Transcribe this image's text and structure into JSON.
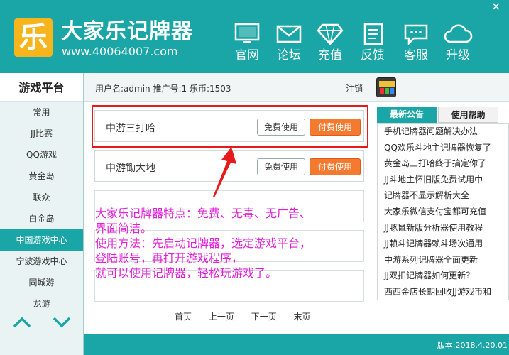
{
  "window": {
    "minimize_glyph": "—",
    "close_glyph": "×"
  },
  "header": {
    "logo_char": "乐",
    "brand_name": "大家乐记牌器",
    "brand_url": "www.40064007.com",
    "nav": [
      {
        "label": "官网",
        "icon": "monitor-icon"
      },
      {
        "label": "论坛",
        "icon": "envelope-icon"
      },
      {
        "label": "充值",
        "icon": "diamond-icon"
      },
      {
        "label": "反馈",
        "icon": "document-icon"
      },
      {
        "label": "客服",
        "icon": "chat-icon"
      },
      {
        "label": "升级",
        "icon": "cloud-icon"
      }
    ]
  },
  "sidebar": {
    "title": "游戏平台",
    "items": [
      {
        "label": "常用"
      },
      {
        "label": "JJ比赛"
      },
      {
        "label": "QQ游戏"
      },
      {
        "label": "黄金岛"
      },
      {
        "label": "联众"
      },
      {
        "label": "白金岛"
      },
      {
        "label": "中国游戏中心"
      },
      {
        "label": "宁波游戏中心"
      },
      {
        "label": "同城游"
      },
      {
        "label": "龙游"
      }
    ],
    "active_index": 6
  },
  "info_bar": {
    "user_text": "用户名:admin  推广号:1  乐币:1503",
    "logout": "注销"
  },
  "games": [
    {
      "name": "中游三打哈",
      "free_label": "免费使用",
      "paid_label": "付费使用"
    },
    {
      "name": "中游锄大地",
      "free_label": "免费使用",
      "paid_label": "付费使用"
    }
  ],
  "overlay_text": [
    "大家乐记牌器特点：免费、无毒、无广告、",
    "界面简洁。",
    "使用方法：先启动记牌器，选定游戏平台，",
    "登陆账号，再打开游戏程序，",
    "就可以使用记牌器，轻松玩游戏了。"
  ],
  "pager": {
    "first": "首页",
    "prev": "上一页",
    "next": "下一页",
    "last": "末页"
  },
  "right_panel": {
    "tabs": [
      "最新公告",
      "使用帮助"
    ],
    "news": [
      "手机记牌器问题解决办法",
      "QQ欢乐斗地主记牌器恢复了",
      "黄金岛三打哈终于搞定你了",
      "JJ斗地主怀旧版免费试用中",
      "记牌器不显示解析大全",
      "大家乐微信支付宝都可充值",
      "JJ豚鼠新版分析器使用教程",
      "JJ赖斗记牌器赖斗场次通用",
      "中游系列记牌器全面更新",
      "JJ双扣记牌器如何更新？",
      "西西金店长期回收JJ游戏币和"
    ]
  },
  "footer": {
    "version": "版本:2018.4.20.01"
  },
  "colors": {
    "teal": "#1aa6a6",
    "orange": "#f47a30",
    "magenta": "#e21fd9",
    "red": "#e61a1a",
    "logo_yellow": "#f6b51d"
  }
}
